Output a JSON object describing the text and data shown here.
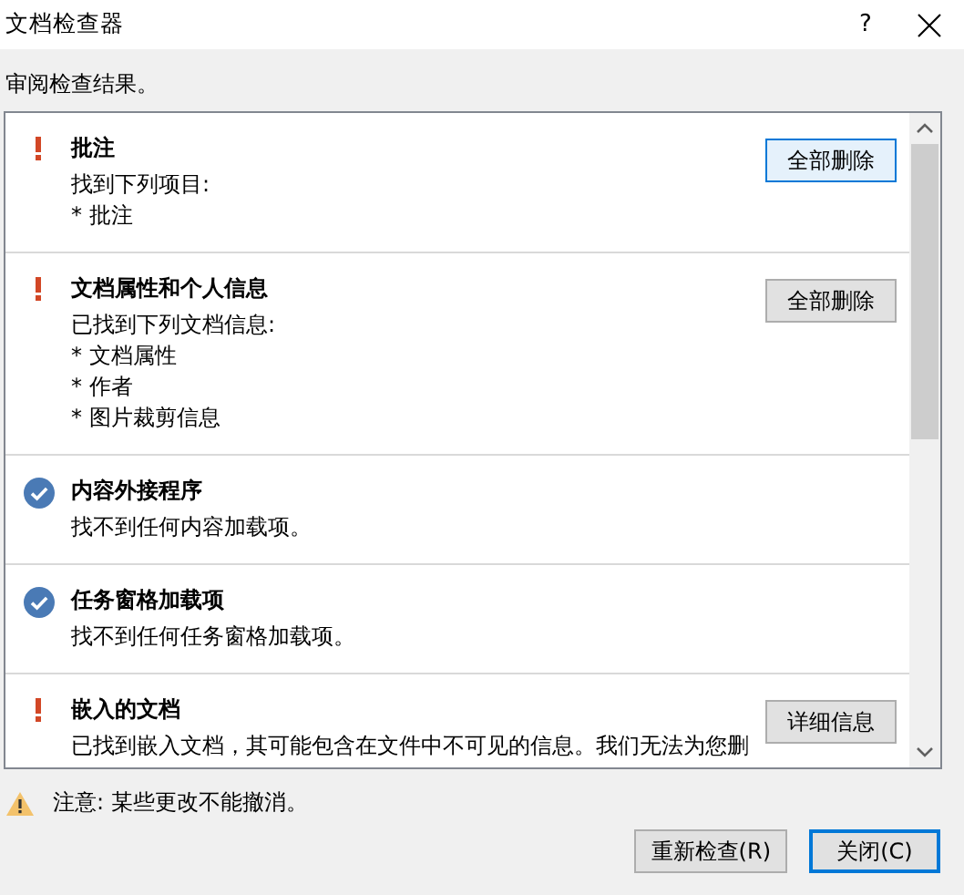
{
  "window": {
    "title": "文档检查器",
    "help": "?"
  },
  "subtitle": "审阅检查结果。",
  "results": [
    {
      "kind": "issue",
      "title": "批注",
      "lines": [
        "找到下列项目:",
        "* 批注"
      ],
      "button": {
        "label": "全部删除",
        "focused": true
      }
    },
    {
      "kind": "issue",
      "title": "文档属性和个人信息",
      "lines": [
        "已找到下列文档信息:",
        "* 文档属性",
        "* 作者",
        "* 图片裁剪信息"
      ],
      "button": {
        "label": "全部删除",
        "focused": false
      }
    },
    {
      "kind": "ok",
      "title": "内容外接程序",
      "lines": [
        "找不到任何内容加载项。"
      ]
    },
    {
      "kind": "ok",
      "title": "任务窗格加载项",
      "lines": [
        "找不到任何任务窗格加载项。"
      ]
    },
    {
      "kind": "issue",
      "title": "嵌入的文档",
      "lines": [
        "已找到嵌入文档，其可能包含在文件中不可见的信息。我们无法为您删"
      ],
      "button": {
        "label": "详细信息",
        "focused": false
      }
    }
  ],
  "warning": "注意: 某些更改不能撤消。",
  "buttons": [
    {
      "label": "重新检查(R)",
      "default": false
    },
    {
      "label": "关闭(C)",
      "default": true
    }
  ]
}
